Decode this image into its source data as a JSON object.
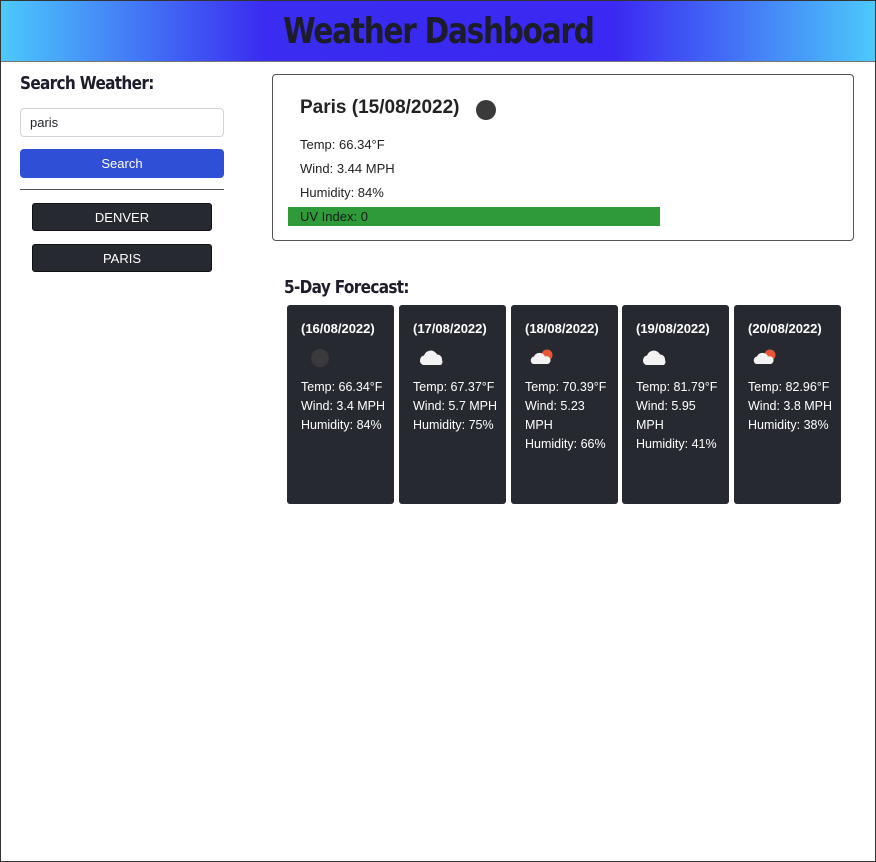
{
  "header": {
    "title": "Weather Dashboard"
  },
  "sidebar": {
    "title": "Search Weather:",
    "search_value": "paris",
    "search_button": "Search",
    "history": [
      "DENVER",
      "PARIS"
    ]
  },
  "current": {
    "heading": "Paris (15/08/2022)",
    "icon": "dark-moon-icon",
    "temp": "Temp: 66.34°F",
    "wind": "Wind: 3.44 MPH",
    "humidity": "Humidity: 84%",
    "uv": "UV Index: 0",
    "uv_color": "#2e9a3a"
  },
  "forecast": {
    "title": "5-Day Forecast:",
    "days": [
      {
        "date": "(16/08/2022)",
        "icon": "dark-moon-icon",
        "temp": "Temp: 66.34°F",
        "wind": "Wind: 3.4 MPH",
        "humidity": "Humidity: 84%"
      },
      {
        "date": "(17/08/2022)",
        "icon": "cloud-icon",
        "temp": "Temp: 67.37°F",
        "wind": "Wind: 5.7 MPH",
        "humidity": "Humidity: 75%"
      },
      {
        "date": "(18/08/2022)",
        "icon": "sun-cloud-icon",
        "temp": "Temp: 70.39°F",
        "wind": "Wind: 5.23 MPH",
        "humidity": "Humidity: 66%"
      },
      {
        "date": "(19/08/2022)",
        "icon": "cloud-icon",
        "temp": "Temp: 81.79°F",
        "wind": "Wind: 5.95 MPH",
        "humidity": "Humidity: 41%"
      },
      {
        "date": "(20/08/2022)",
        "icon": "sun-cloud-icon",
        "temp": "Temp: 82.96°F",
        "wind": "Wind: 3.8 MPH",
        "humidity": "Humidity: 38%"
      }
    ]
  }
}
